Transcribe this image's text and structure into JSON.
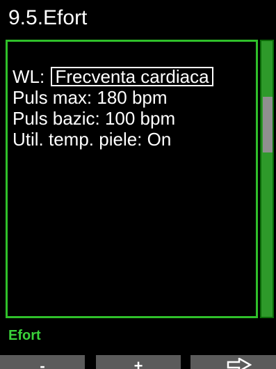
{
  "header": {
    "title": "9.5.Efort"
  },
  "settings": {
    "wl_label": "WL:",
    "wl_value": "Frecventa cardiaca",
    "puls_max": "Puls max: 180 bpm",
    "puls_bazic": "Puls bazic: 100 bpm",
    "util_temp": "Util. temp. piele: On"
  },
  "footer": {
    "mode_label": "Efort"
  },
  "softkeys": {
    "left": "-",
    "middle": "+",
    "right_icon": "arrow-right-icon"
  },
  "colors": {
    "accent_green": "#2fc02a",
    "scrollbar_green": "#2e9a2a",
    "label_green": "#3ad23a"
  }
}
